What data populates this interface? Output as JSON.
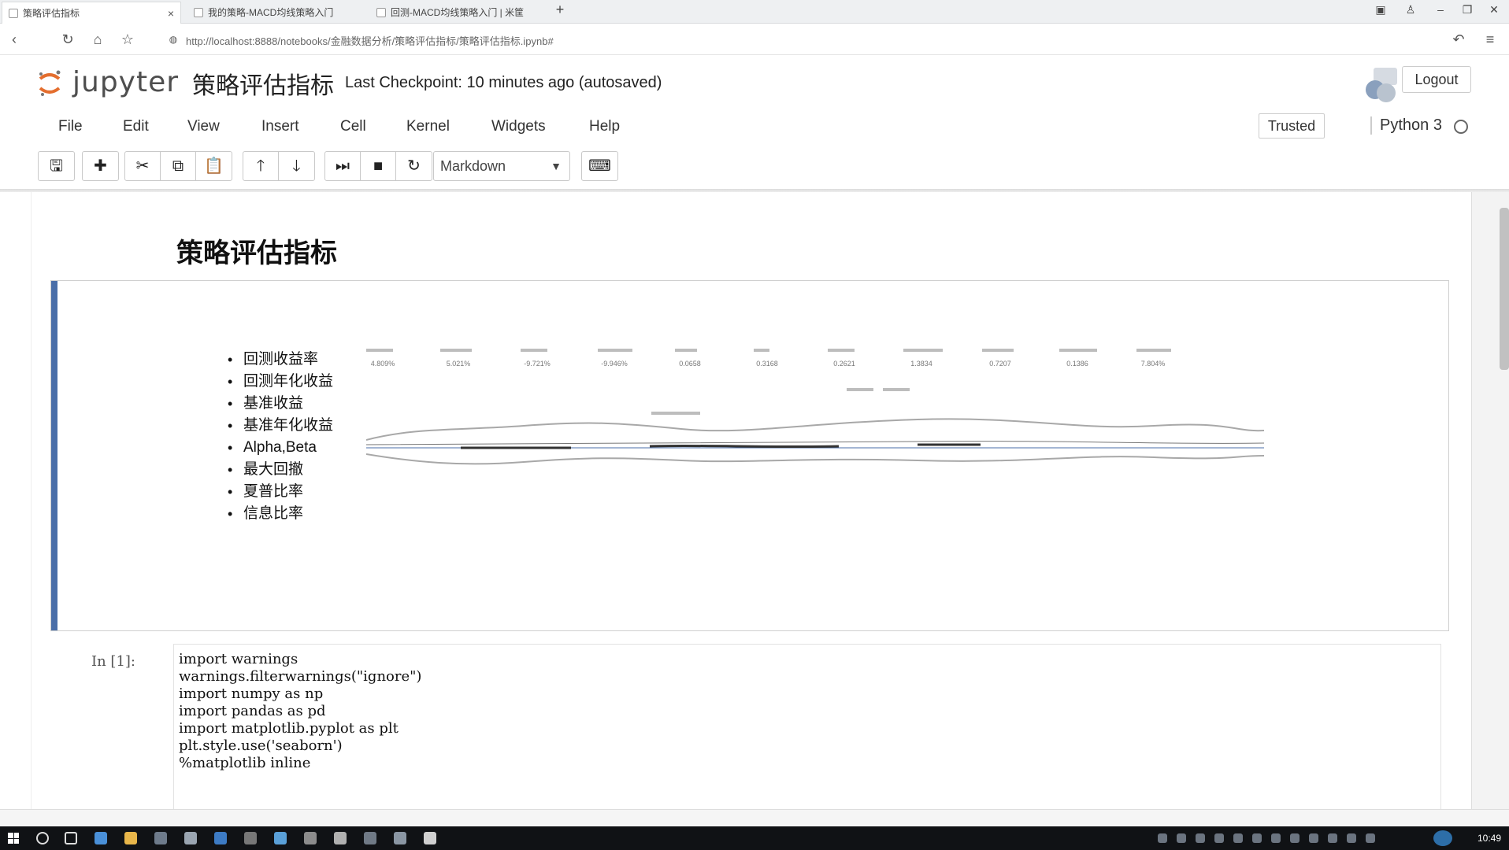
{
  "browser": {
    "tabs": [
      {
        "title": "策略评估指标",
        "active": true
      },
      {
        "title": "我的策略-MACD均线策略入门",
        "active": false
      },
      {
        "title": "回测-MACD均线策略入门 | 米筐",
        "active": false
      }
    ],
    "new_tab": "+",
    "url": "http://localhost:8888/notebooks/金融数据分析/策略评估指标/策略评估指标.ipynb#"
  },
  "jupyter": {
    "logo_text": "jupyter",
    "notebook_name": "策略评估指标",
    "checkpoint": "Last Checkpoint: 10 minutes ago (autosaved)",
    "logout": "Logout",
    "menu": [
      "File",
      "Edit",
      "View",
      "Insert",
      "Cell",
      "Kernel",
      "Widgets",
      "Help"
    ],
    "trusted": "Trusted",
    "kernel": "Python 3",
    "cell_type": "Markdown"
  },
  "toolbar_icons": {
    "group1": [
      "save-icon"
    ],
    "group2": [
      "plus-icon"
    ],
    "group3": [
      "cut-icon",
      "copy-icon",
      "paste-icon"
    ],
    "group4": [
      "arrow-up-icon",
      "arrow-down-icon"
    ],
    "group5": [
      "run-icon",
      "stop-icon",
      "restart-icon"
    ],
    "keyboard": "keyboard-icon"
  },
  "markdown": {
    "heading": "策略评估指标",
    "items": [
      "回测收益率",
      "回测年化收益",
      "基准收益",
      "基准年化收益",
      "Alpha,Beta",
      "最大回撤",
      "夏普比率",
      "信息比率"
    ],
    "preview_values": [
      "4.809%",
      "5.021%",
      "-9.721%",
      "-9.946%",
      "0.0658",
      "0.3168",
      "0.2621",
      "1.3834",
      "0.7207",
      "0.1386",
      "7.804%"
    ]
  },
  "code_cell": {
    "prompt": "In  [1]:",
    "lines": [
      "import warnings",
      "warnings.filterwarnings(\"ignore\")",
      "import numpy as np",
      "import pandas as pd",
      "import matplotlib.pyplot as plt",
      "plt.style.use('seaborn')",
      "%matplotlib inline"
    ]
  },
  "colors": {
    "cell_bar": "#4a6ea8",
    "taskbar": "#101215"
  },
  "taskbar": {
    "clock": "10:49"
  }
}
